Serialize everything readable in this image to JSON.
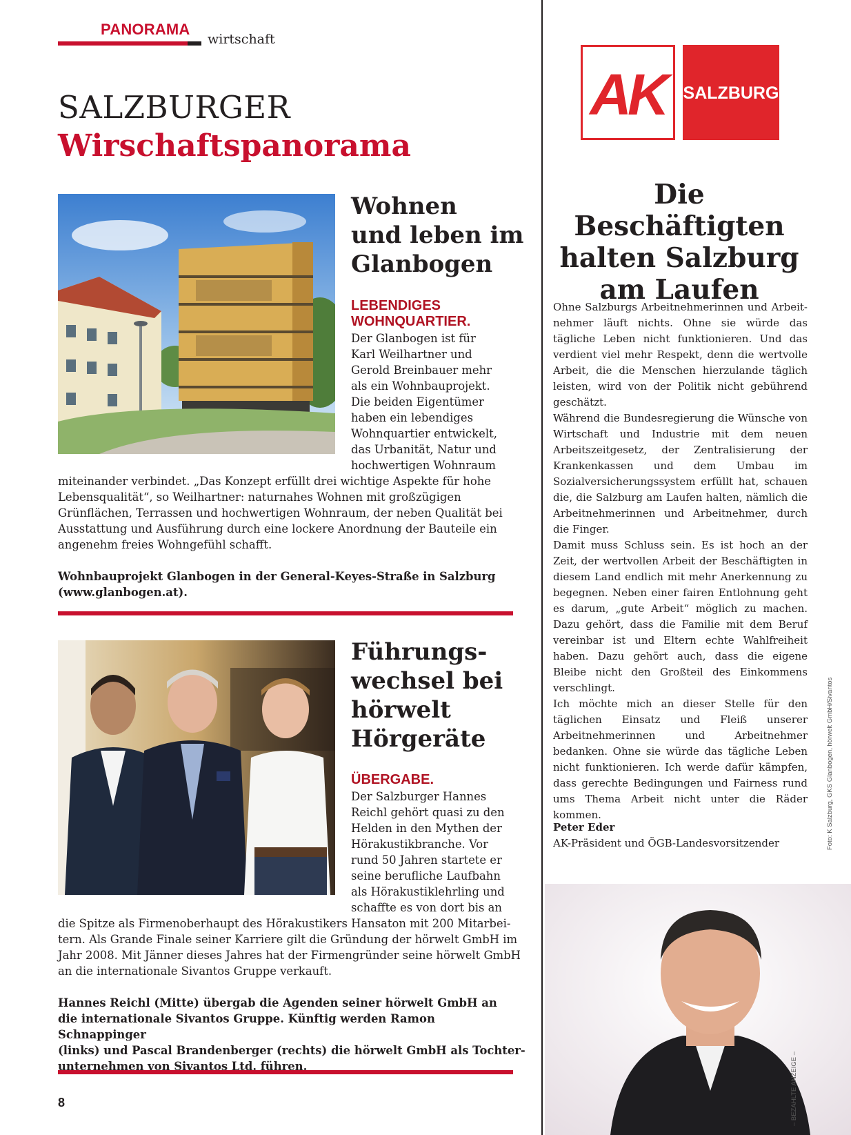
{
  "header": {
    "section": "PANORAMA",
    "subsection": "wirtschaft",
    "title_line1": "SALZBURGER",
    "title_line2": "Wirschaftspanorama"
  },
  "articles": [
    {
      "headline": [
        "Wohnen",
        "und leben im",
        "Glanbogen"
      ],
      "kicker": [
        "LEBENDIGES",
        "WOHNQUARTIER."
      ],
      "body_narrow": [
        "Der Glanbogen ist für",
        "Karl Weilhartner und",
        "Gerold Breinbauer mehr",
        "als ein Wohnbauprojekt.",
        "Die beiden Eigentümer",
        "haben ein lebendiges",
        "Wohnquartier entwickelt,",
        "das Urbanität, Natur und",
        "hochwertigen Wohnraum"
      ],
      "body_wide": [
        "miteinander verbindet. „Das Konzept erfüllt drei wichtige Aspekte für hohe",
        "Lebensqualität“, so Weilhartner: naturnahes Wohnen mit großzügigen",
        "Grünflächen, Terrassen und hochwertigen Wohnraum, der neben Qualität bei",
        "Ausstattung und Ausführung durch eine lockere Anordnung der Bauteile ein",
        "angenehm freies Wohngefühl schafft."
      ],
      "caption": [
        "Wohnbauprojekt Glanbogen in der General-Keyes-Straße in Salzburg",
        "(www.glanbogen.at)."
      ]
    },
    {
      "headline": [
        "Führungs-",
        "wechsel bei",
        "hörwelt",
        "Hörgeräte"
      ],
      "kicker": [
        "ÜBERGABE."
      ],
      "body_narrow": [
        "Der Salzburger Hannes",
        "Reichl gehört quasi zu den",
        "Helden in den Mythen der",
        "Hörakustikbranche. Vor",
        "rund 50 Jahren startete er",
        "seine berufliche Laufbahn",
        "als Hörakustiklehrling und",
        "schaffte es von dort bis an"
      ],
      "body_wide": [
        "die Spitze als Firmenoberhaupt des Hörakustikers Hansaton mit 200 Mitarbei-",
        "tern. Als Grande Finale seiner Karriere gilt die Gründung der hörwelt GmbH im",
        "Jahr 2008. Mit Jänner dieses Jahres hat der Firmengründer seine hörwelt GmbH",
        "an die internationale Sivantos Gruppe verkauft."
      ],
      "caption": [
        "Hannes Reichl (Mitte) übergab die Agenden seiner hörwelt GmbH an",
        "die internationale Sivantos Gruppe. Künftig werden Ramon Schnappinger",
        "(links) und Pascal Brandenberger (rechts) die hörwelt GmbH als Tochter-",
        "unternehmen von Sivantos Ltd. führen."
      ]
    }
  ],
  "ad": {
    "logo_letters": "AK",
    "logo_text": "SALZBURG",
    "headline": [
      "Die Beschäftigten",
      "halten Salzburg",
      "am Laufen"
    ],
    "paragraphs": [
      "Ohne Salzburgs Arbeitnehmerinnen und Arbeit­nehmer läuft nichts. Ohne sie würde das tägliche Leben nicht funktionieren. Und das verdient viel mehr Respekt, denn die wertvolle Arbeit, die die Menschen hierzulande täglich leisten, wird von der Politik nicht gebührend geschätzt.",
      "Während die Bundesregierung die Wünsche von Wirtschaft und Industrie mit dem neuen Arbeits­zeitgesetz, der Zentralisierung der Kranken­kassen und dem Umbau im Sozialversicherungs­system erfüllt hat, schauen die, die Salzburg am Laufen halten, nämlich die Arbeitnehmerinnen und Arbeitnehmer, durch die Finger.",
      "Damit muss Schluss sein. Es ist hoch an der Zeit, der wertvollen Arbeit der Beschäftigten in die­sem Land endlich mit mehr Anerkennung zu begegnen. Neben einer fairen Entlohnung geht es darum, „gute Arbeit“ möglich zu machen. Dazu gehört, dass die Familie mit dem Beruf ver­einbar ist und Eltern echte Wahlfreiheit haben. Dazu gehört auch, dass die eigene Bleibe nicht den Großteil des Einkommens verschlingt.",
      "Ich möchte mich an dieser Stelle für den täglichen Einsatz und Fleiß unserer Arbeitnehmerinnen und Arbeitnehmer bedanken. Ohne sie würde das tägliche Leben nicht funktionieren. Ich werde dafür kämpfen, dass gerechte Bedingungen und Fairness rund ums Thema Arbeit nicht unter die Räder kommen."
    ],
    "signer_name": "Peter Eder",
    "signer_role": "AK-Präsident und ÖGB-Landesvorsitzender"
  },
  "photo_credit": "Foto: K Salzburg, GKS Glanbogen, hörwelt GmbH/Sivantos",
  "ad_label": "– BEZAHLTE ANZEIGE –",
  "page_number": "8",
  "colors": {
    "accent_red": "#c8102e",
    "kicker_red": "#b01323",
    "text": "#231f20"
  }
}
